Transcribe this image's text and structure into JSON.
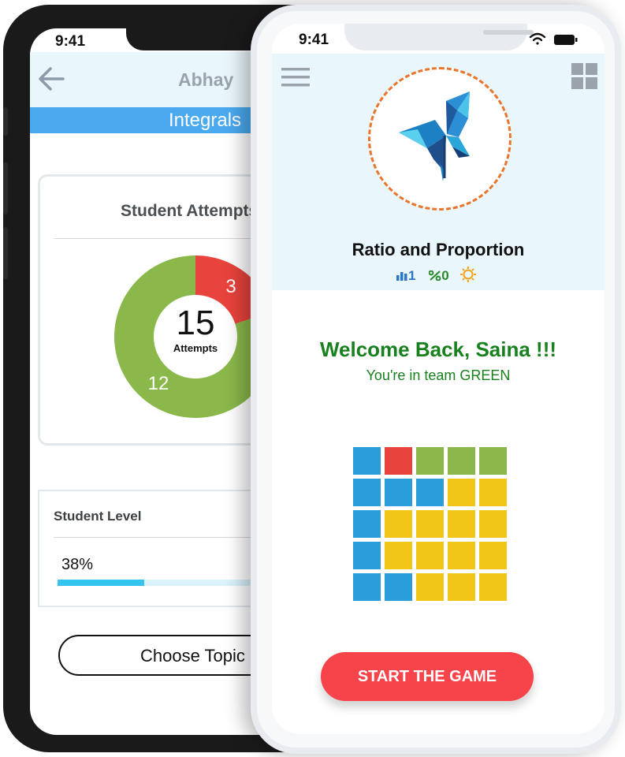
{
  "back_phone": {
    "status_time": "9:41",
    "header_name": "Abhay",
    "topic_banner": "Integrals",
    "attempts_card": {
      "title": "Student Attempts",
      "total": "15",
      "total_label": "Attempts",
      "incorrect_count": "3",
      "correct_count": "12",
      "correct_color": "#8ab84a",
      "incorrect_color": "#e8433c",
      "incorrect_value": 3,
      "correct_value": 12
    },
    "level_card": {
      "title": "Student Level",
      "percent_text": "38%",
      "progress_fraction": 0.38
    },
    "choose_button": "Choose Topic"
  },
  "front_phone": {
    "status_time": "9:41",
    "header": {
      "menu_icon": "hamburger-menu-icon",
      "apps_icon": "grid-apps-icon",
      "logo_icon": "butterfly-logo-icon"
    },
    "topic_title": "Ratio and Proportion",
    "stats": {
      "rank_value": "1",
      "percent_value": "0",
      "rank_icon": "bar-chart-icon",
      "percent_icon": "percent-icon",
      "sun_icon": "sun-icon"
    },
    "welcome_text": "Welcome Back, Saina !!!",
    "team_text": "You're in team GREEN",
    "tile_colors": {
      "blue": "#2a9ddb",
      "red": "#e8433c",
      "green": "#8ab84a",
      "yellow": "#f2c617"
    },
    "tiles": [
      [
        "blue",
        "red",
        "green",
        "green",
        "green"
      ],
      [
        "blue",
        "blue",
        "blue",
        "yellow",
        "yellow"
      ],
      [
        "blue",
        "yellow",
        "yellow",
        "yellow",
        "yellow"
      ],
      [
        "blue",
        "yellow",
        "yellow",
        "yellow",
        "yellow"
      ],
      [
        "blue",
        "blue",
        "yellow",
        "yellow",
        "yellow"
      ]
    ],
    "start_button": "START THE GAME"
  }
}
